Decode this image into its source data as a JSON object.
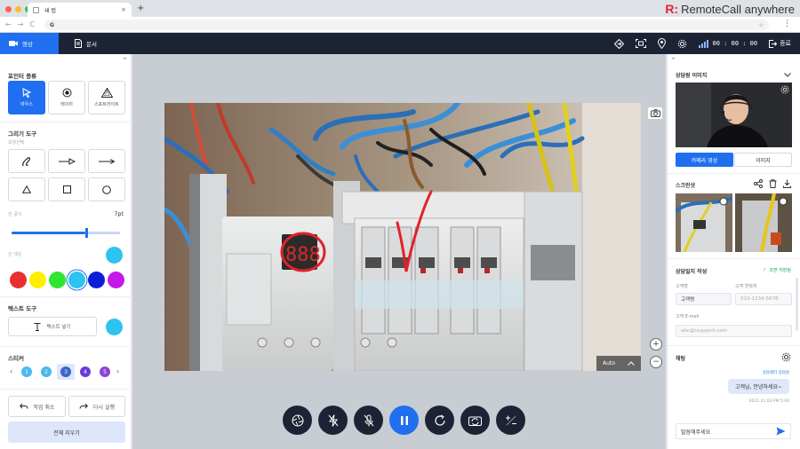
{
  "browser": {
    "tab_title": "새 탭",
    "tab_close": "×",
    "new_tab": "+",
    "address_glyph": "G",
    "star": "☆",
    "nav_back": "←",
    "nav_forward": "→",
    "nav_reload": "C",
    "menu": "⋮"
  },
  "brand": {
    "mark": "R:",
    "name": "RemoteCall anywhere"
  },
  "appbar": {
    "tabs": [
      {
        "label": "영상",
        "active": true
      },
      {
        "label": "문서",
        "active": false
      }
    ],
    "timer": "00 : 00 : 00",
    "end_label": "종료"
  },
  "left": {
    "pointer_title": "포인터 종류",
    "pointers": [
      {
        "label": "마우스",
        "icon": "cursor-icon",
        "active": true
      },
      {
        "label": "레이저",
        "icon": "laser-icon",
        "active": false
      },
      {
        "label": "스포트라이트",
        "icon": "spotlight-icon",
        "active": false
      }
    ],
    "draw_title": "그리기 도구",
    "shape_sub": "모양선택",
    "thickness_sub": "선 굵기",
    "thickness_value": "7pt",
    "thickness_fraction": 0.68,
    "color_sub": "선 색상",
    "colors": [
      "#e8312f",
      "#ffee00",
      "#2ee62e",
      "#2ec3f0",
      "#0b1fd6",
      "#c419e8"
    ],
    "current_color": "#2ec3f0",
    "text_title": "텍스트 도구",
    "text_button": "텍스트 넣기",
    "sticker_title": "스티커",
    "stickers": [
      "1",
      "2",
      "3",
      "4",
      "5"
    ],
    "undo": "작업 취소",
    "redo": "다시 실행",
    "clear_all": "전체 지우기"
  },
  "center": {
    "auto_label": "Auto"
  },
  "right": {
    "agent_image_title": "상담원 이미지",
    "cam_tab": "카메라 영상",
    "img_tab": "이미지",
    "screenshot_title": "스크린샷",
    "log_title": "상담일지 작성",
    "saved_label": "조면 저장됨",
    "customer_name_label": "고객명",
    "customer_name_value": "고객명",
    "customer_phone_label": "고객 연락처",
    "customer_phone_placeholder": "010-1234-5678",
    "customer_email_label": "고객 E-mail",
    "customer_email_placeholder": "abc@rsupport.com",
    "chat_title": "채팅",
    "chat_sender": "상담센터 상담원",
    "chat_message": "고객님, 안녕하세요~",
    "chat_time": "2021.11.03 PM 5:00",
    "chat_input": "말씀해주세요"
  }
}
